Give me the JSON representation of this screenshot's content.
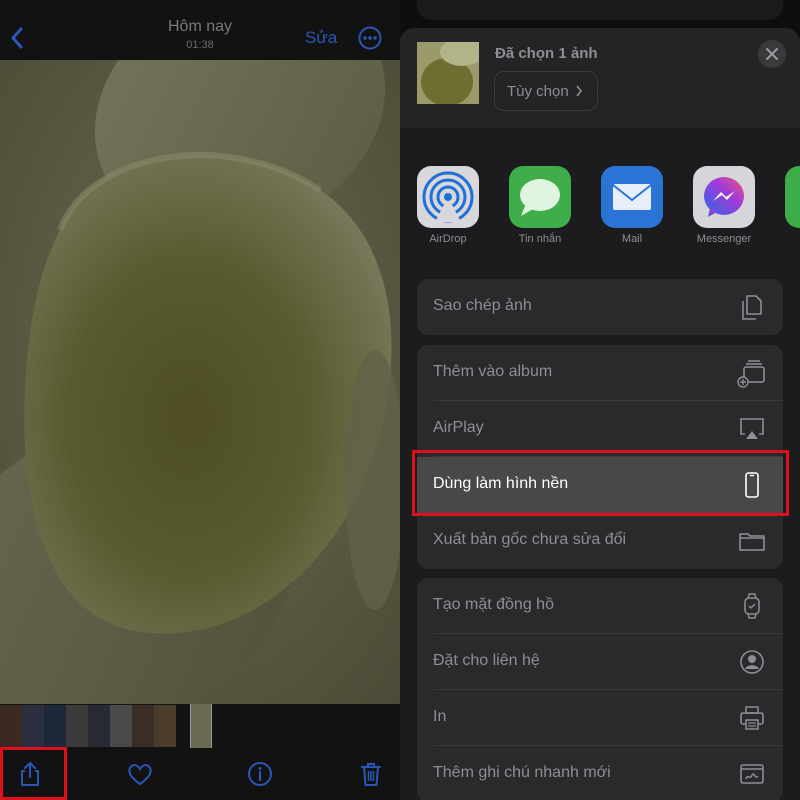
{
  "left": {
    "nav": {
      "title": "Hôm nay",
      "subtitle": "01:38",
      "edit_label": "Sửa"
    },
    "toolbar": {
      "share": "share-icon",
      "favorite": "heart-icon",
      "info": "info-icon",
      "delete": "trash-icon"
    }
  },
  "share_sheet": {
    "header": {
      "title": "Đã chọn 1 ảnh",
      "options_label": "Tùy chọn"
    },
    "apps": [
      {
        "label": "AirDrop",
        "icon": "airdrop-icon"
      },
      {
        "label": "Tin nhắn",
        "icon": "messages-icon"
      },
      {
        "label": "Mail",
        "icon": "mail-icon"
      },
      {
        "label": "Messenger",
        "icon": "messenger-icon"
      }
    ],
    "actions": {
      "copy_photo": "Sao chép ảnh",
      "add_to_album": "Thêm vào album",
      "airplay": "AirPlay",
      "use_as_wallpaper": "Dùng làm hình nền",
      "export_original": "Xuất bản gốc chưa sửa đổi",
      "create_watch_face": "Tạo mặt đồng hồ",
      "assign_to_contact": "Đặt cho liên hệ",
      "print": "In",
      "add_quick_note": "Thêm ghi chú nhanh mới"
    }
  },
  "colors": {
    "accent_blue": "#2a57b5",
    "highlight_red": "#e0101a",
    "sheet_bg": "#1c1c1e",
    "row_bg": "#2a2a2c"
  }
}
